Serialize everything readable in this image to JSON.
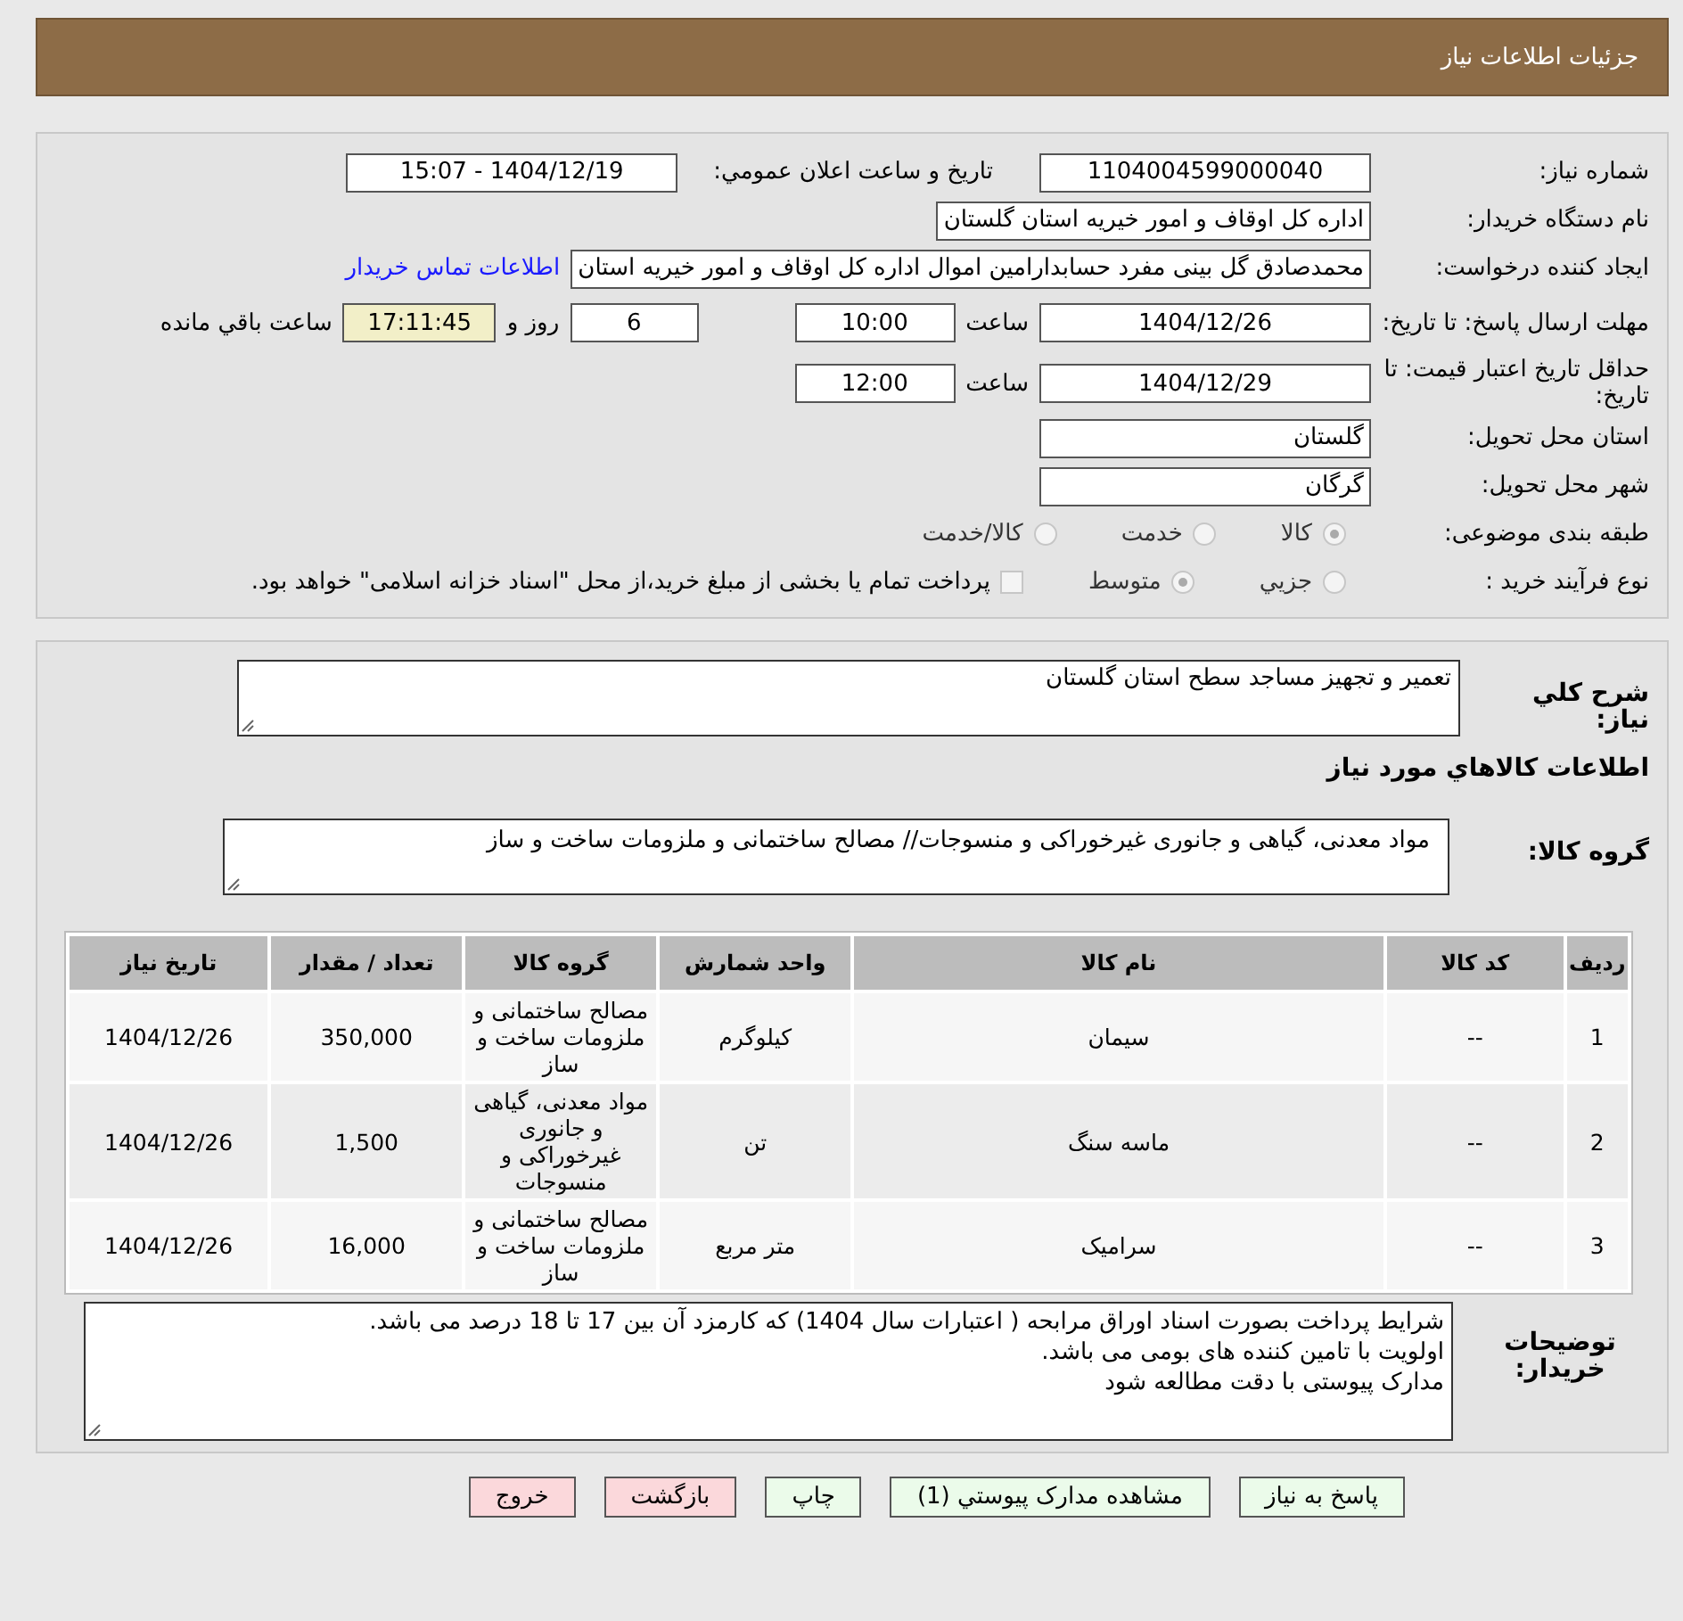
{
  "header": {
    "title": "جزئیات اطلاعات نیاز"
  },
  "need_number": {
    "label": "شماره نیاز:",
    "value": "1104004599000040"
  },
  "announce": {
    "label": "تاریخ و ساعت اعلان عمومي:",
    "value": "1404/12/19 - 15:07"
  },
  "buyer_org": {
    "label": "نام دستگاه خریدار:",
    "value": "اداره کل اوقاف و امور خیریه استان گلستان"
  },
  "requester": {
    "label": "ایجاد کننده درخواست:",
    "value": "محمدصادق گل بینی مفرد حسابدارامین اموال اداره کل اوقاف و امور خیریه استان",
    "contact_link": "اطلاعات تماس خریدار"
  },
  "reply_deadline": {
    "label": "مهلت ارسال پاسخ: تا تاریخ:",
    "date": "1404/12/26",
    "time_label": "ساعت",
    "time": "10:00",
    "days": "6",
    "days_label": "روز و",
    "remaining": "17:11:45",
    "remaining_label": "ساعت باقي مانده"
  },
  "price_validity": {
    "label": "حداقل تاریخ اعتبار قیمت: تا تاریخ:",
    "date": "1404/12/29",
    "time_label": "ساعت",
    "time": "12:00"
  },
  "province": {
    "label": "استان محل تحویل:",
    "value": "گلستان"
  },
  "city": {
    "label": "شهر محل تحویل:",
    "value": "گرگان"
  },
  "category": {
    "label": "طبقه بندی موضوعی:",
    "options": [
      {
        "label": "کالا",
        "selected": true
      },
      {
        "label": "خدمت",
        "selected": false
      },
      {
        "label": "کالا/خدمت",
        "selected": false
      }
    ]
  },
  "process": {
    "label": "نوع فرآیند خرید :",
    "options": [
      {
        "label": "جزيي",
        "selected": false
      },
      {
        "label": "متوسط",
        "selected": true
      }
    ],
    "treasury": {
      "checked": false,
      "text": "پرداخت تمام یا بخشی از مبلغ خرید،از محل \"اسناد خزانه اسلامی\" خواهد بود."
    }
  },
  "description": {
    "label": "شرح کلي نیاز:",
    "value": "تعمیر و تجهیز مساجد سطح استان گلستان"
  },
  "goods_section": {
    "title": "اطلاعات کالاهاي مورد نیاز"
  },
  "goods_group": {
    "label": "گروه کالا:",
    "value": "مواد معدنی، گیاهی و جانوری غیرخوراکی و منسوجات// مصالح ساختمانی و ملزومات ساخت و ساز"
  },
  "table": {
    "columns": [
      "ردیف",
      "کد کالا",
      "نام کالا",
      "واحد شمارش",
      "گروه کالا",
      "تعداد / مقدار",
      "تاریخ نیاز"
    ],
    "rows": [
      [
        "1",
        "--",
        "سیمان",
        "کیلوگرم",
        "مصالح ساختمانی و ملزومات ساخت و ساز",
        "350,000",
        "1404/12/26"
      ],
      [
        "2",
        "--",
        "ماسه سنگ",
        "تن",
        "مواد معدنی، گیاهی و جانوری غیرخوراکی و منسوجات",
        "1,500",
        "1404/12/26"
      ],
      [
        "3",
        "--",
        "سرامیک",
        "متر مربع",
        "مصالح ساختمانی و ملزومات ساخت و ساز",
        "16,000",
        "1404/12/26"
      ]
    ]
  },
  "buyer_notes": {
    "label": "توضیحات خریدار:",
    "lines": [
      "شرایط پرداخت بصورت اسناد اوراق مرابحه ( اعتبارات سال 1404) که کارمزد آن بین 17 تا 18 درصد می باشد.",
      "اولویت با تامین کننده های بومی می باشد.",
      "مدارک پیوستی با دقت مطالعه شود"
    ]
  },
  "buttons": [
    {
      "label": "پاسخ به نیاز",
      "kind": "normal"
    },
    {
      "label": "مشاهده مدارک پیوستي (1)",
      "kind": "normal"
    },
    {
      "label": "چاپ",
      "kind": "normal"
    },
    {
      "label": "بازگشت",
      "kind": "exit"
    },
    {
      "label": "خروج",
      "kind": "exit"
    }
  ]
}
